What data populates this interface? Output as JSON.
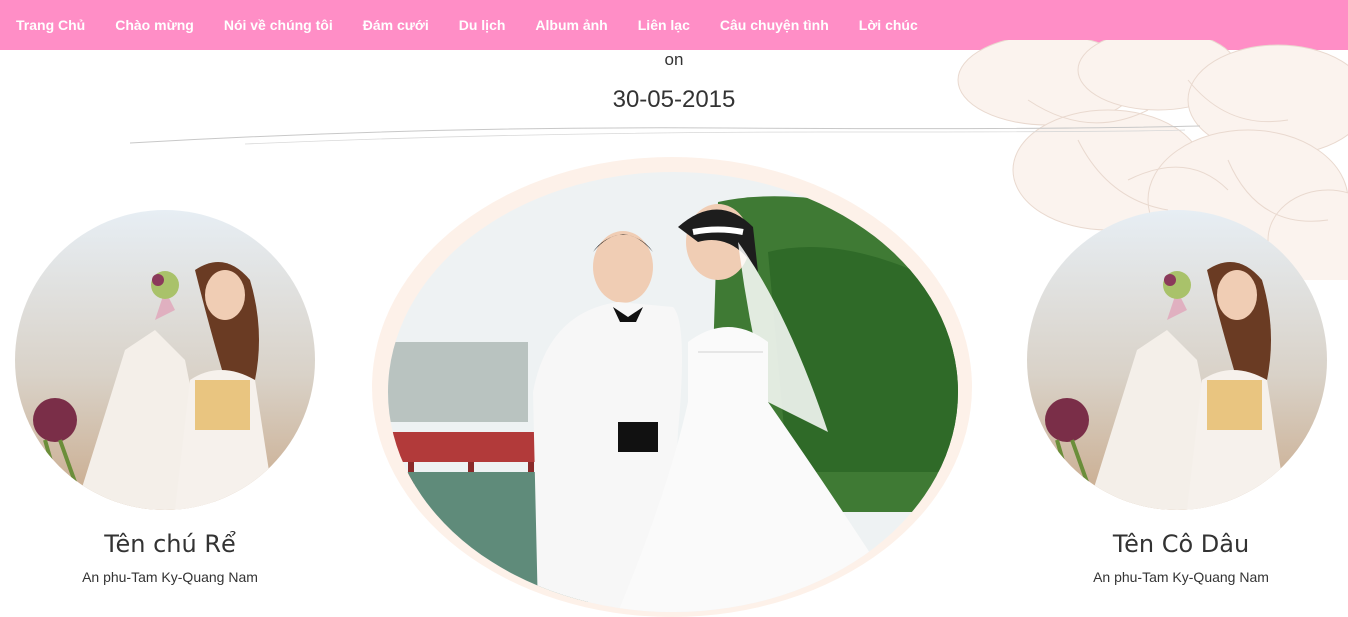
{
  "nav": {
    "items": [
      "Trang Chủ",
      "Chào mừng",
      "Nói về chúng tôi",
      "Đám cưới",
      "Du lịch",
      "Album ảnh",
      "Liên lạc",
      "Câu chuyện tình",
      "Lời chúc"
    ]
  },
  "hero": {
    "on_label": "on",
    "date": "30-05-2015"
  },
  "groom": {
    "name": "Tên chú Rể",
    "address": "An phu-Tam Ky-Quang Nam"
  },
  "bride": {
    "name": "Tên Cô Dâu",
    "address": "An phu-Tam Ky-Quang Nam"
  },
  "colors": {
    "nav_bg": "#ff8ec6",
    "nav_text": "#ffffff",
    "ring": "#fdf1e9"
  }
}
